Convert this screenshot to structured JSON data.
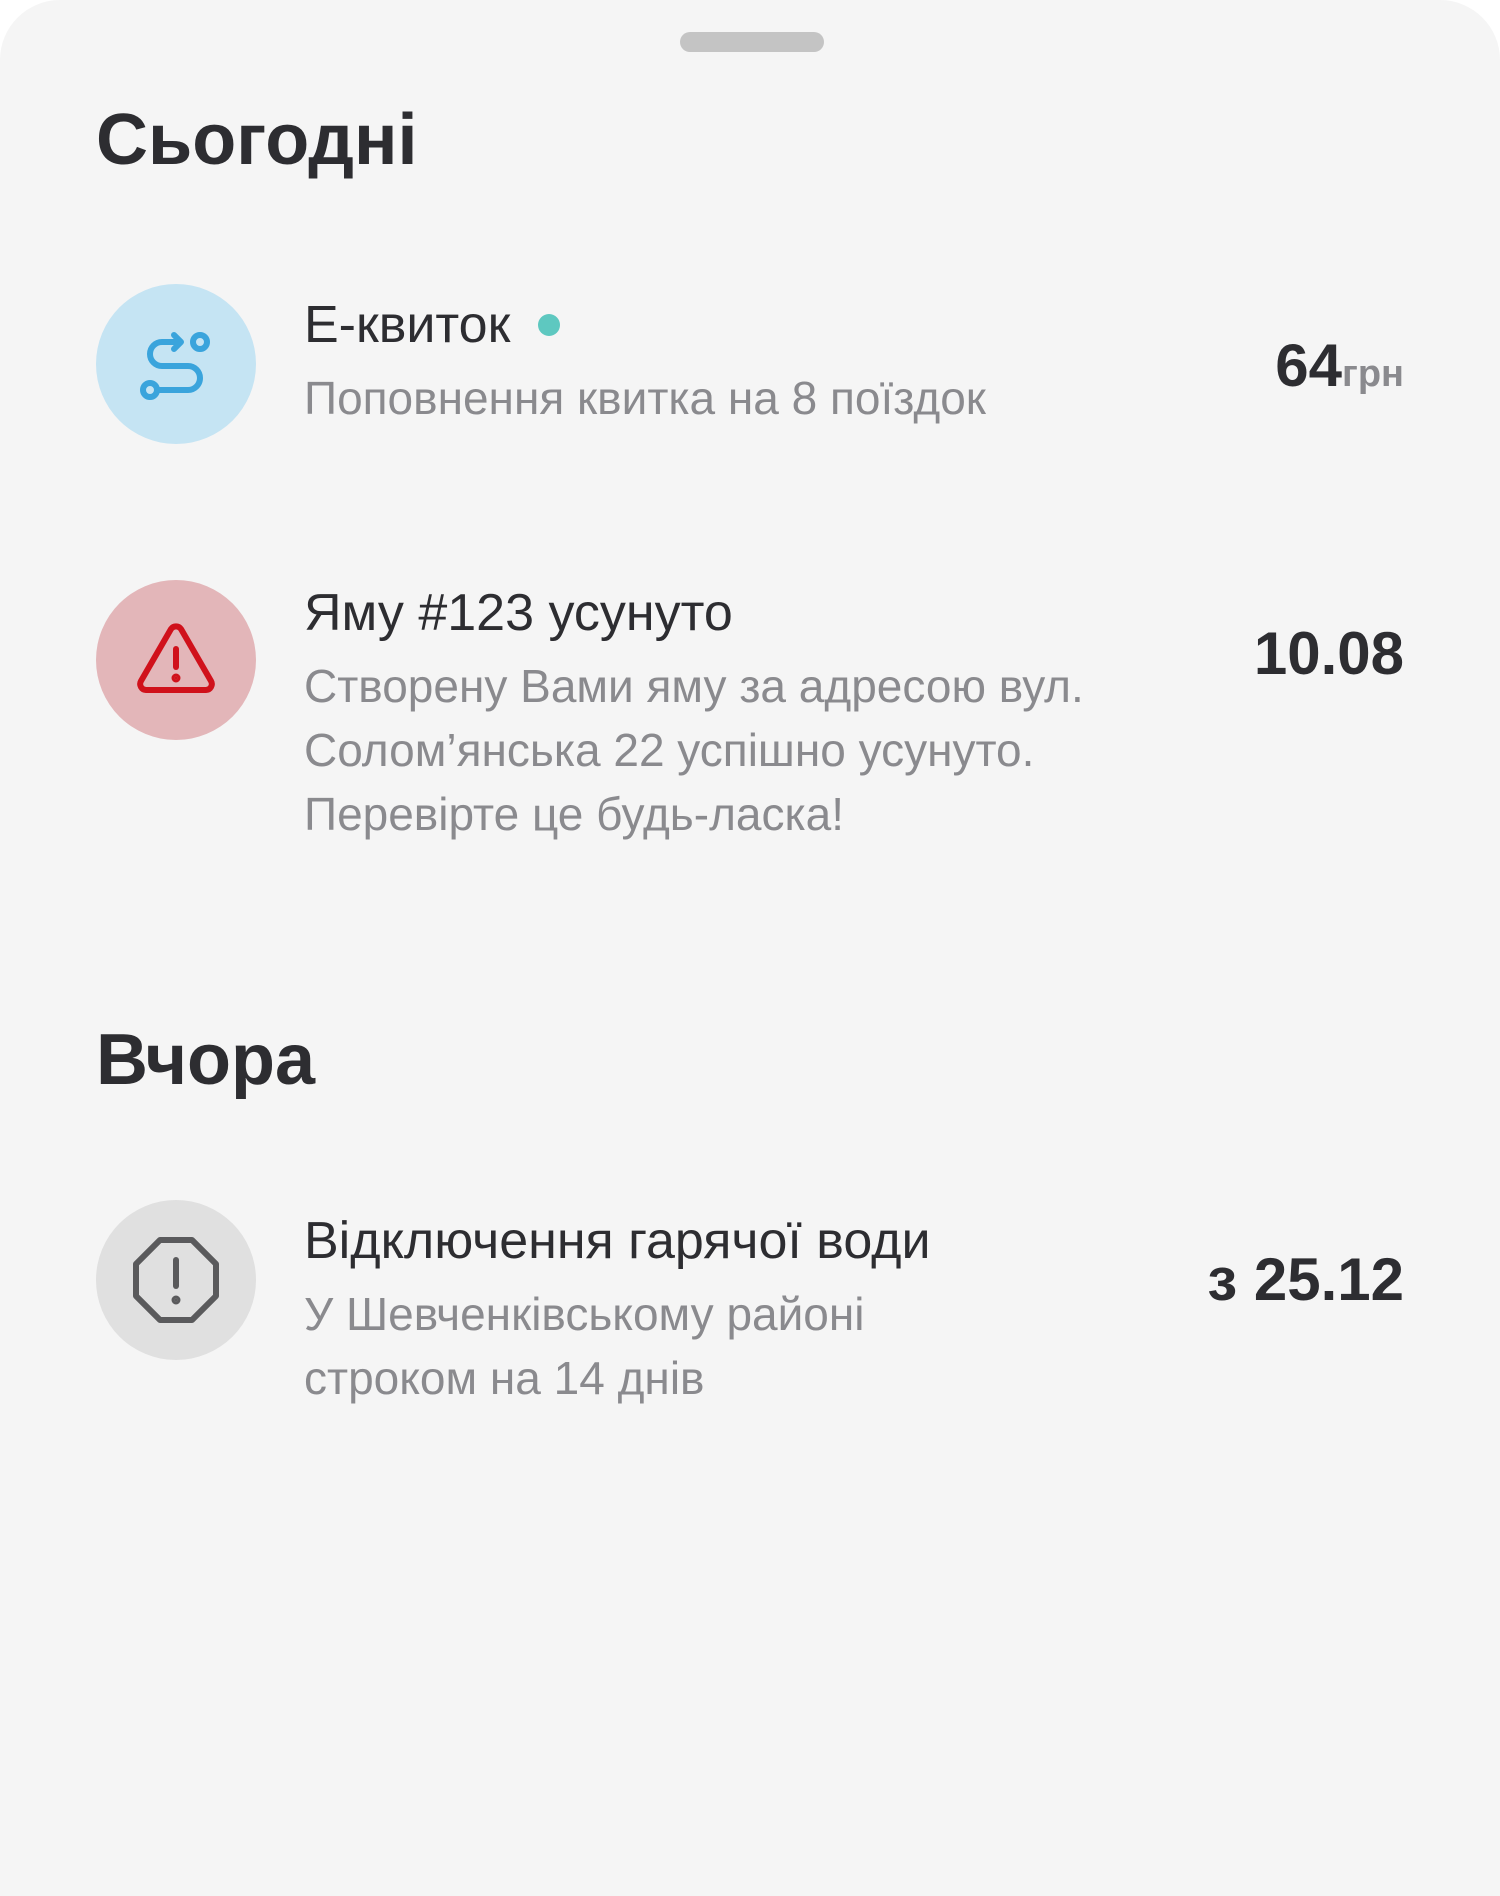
{
  "sections": [
    {
      "title": "Сьогодні",
      "items": [
        {
          "title": "Е-квиток",
          "description": "Поповнення квитка на 8 поїздок",
          "value": "64",
          "currency": "грн",
          "icon": "route-icon",
          "unread": true
        },
        {
          "title": "Яму #123 усунуто",
          "description": "Створену Вами яму за адресою вул. Солом’янська 22 успішно усунуто. Перевірте це будь-ласка!",
          "value": "10.08",
          "icon": "warning-triangle-icon"
        }
      ]
    },
    {
      "title": "Вчора",
      "items": [
        {
          "title": "Відключення гарячої води",
          "description": "У Шевченківському районі строком на 14 днів",
          "value": "з 25.12",
          "icon": "alert-octagon-icon"
        }
      ]
    }
  ],
  "colors": {
    "background": "#f5f5f5",
    "text_primary": "#2d2d31",
    "text_secondary": "#8a8a8e",
    "ticket_icon_bg": "#c5e4f3",
    "ticket_icon": "#3aa4dc",
    "warning_icon_bg": "#e3b6b9",
    "warning_icon": "#d0111b",
    "outage_icon_bg": "#e0e0e0",
    "outage_icon": "#5a5a5c",
    "unread_dot": "#5ec8c0"
  }
}
